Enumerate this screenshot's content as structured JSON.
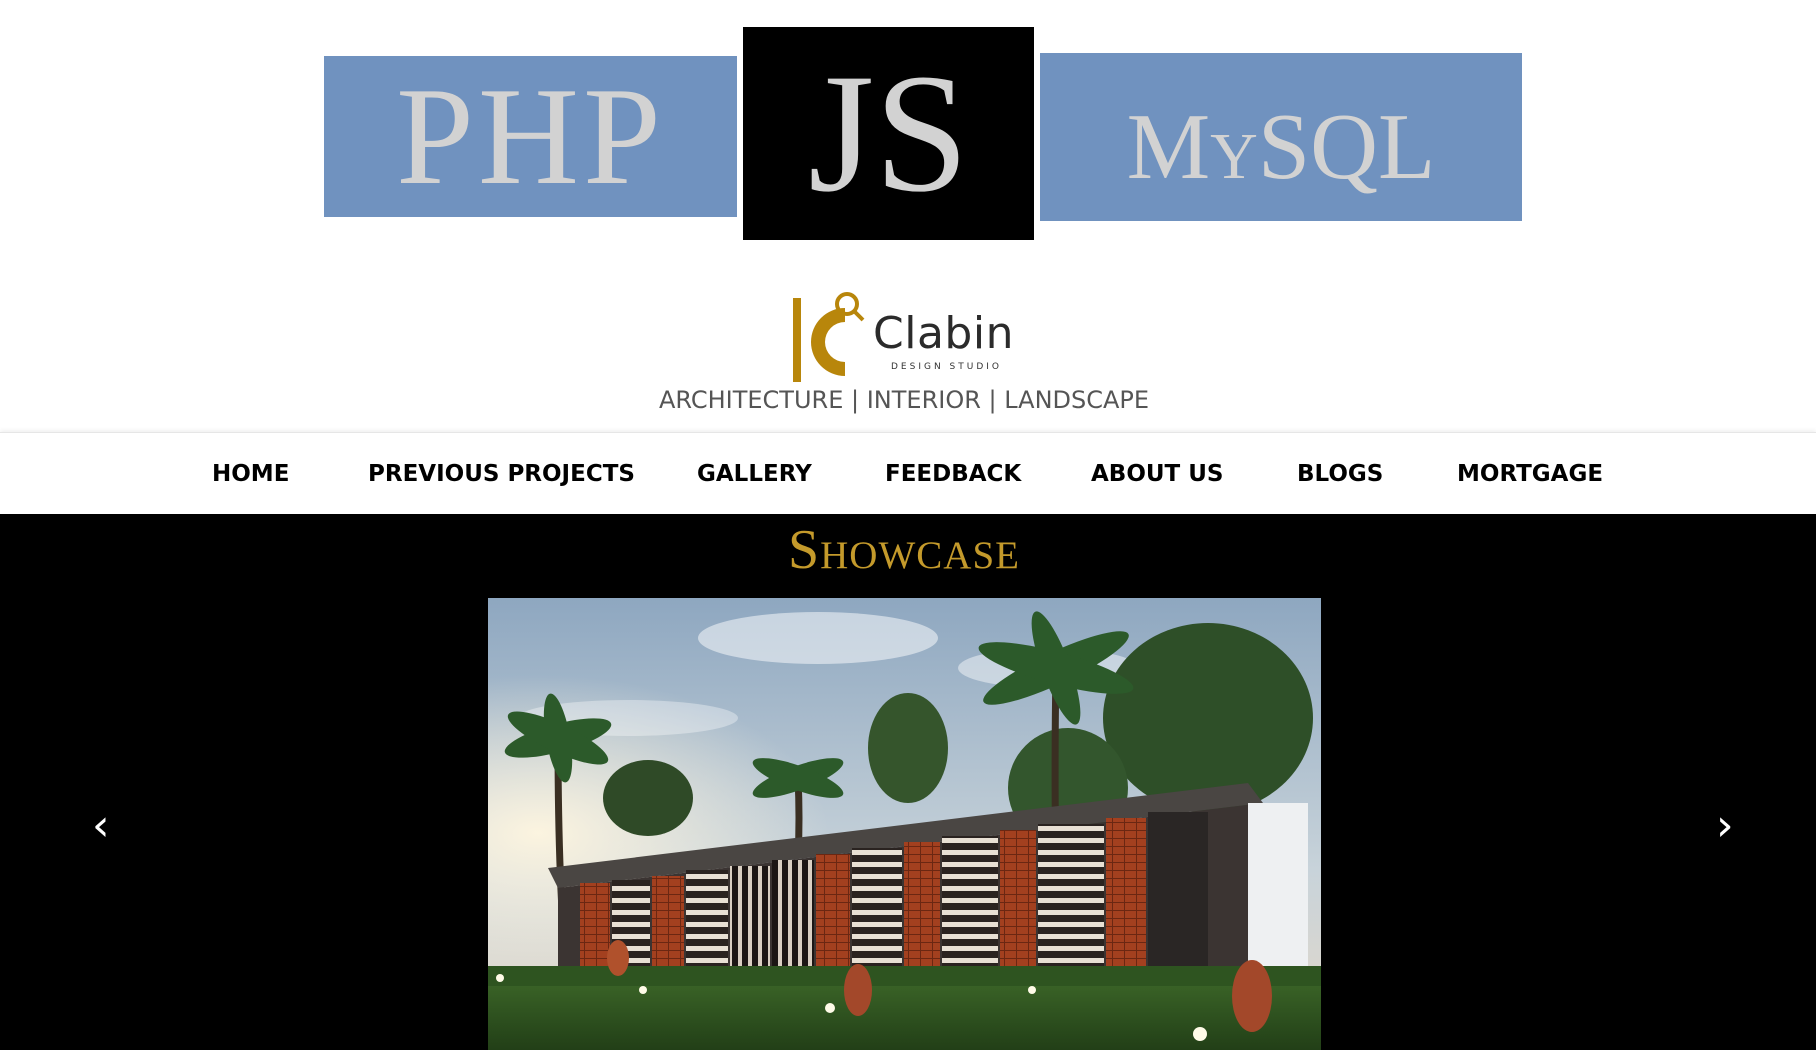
{
  "banner": {
    "php_label": "PHP",
    "js_label": "JS",
    "mysql_label": "MySQL",
    "colors": {
      "block_blue": "#7092bf",
      "block_black": "#000000",
      "text_gray": "#d2d2d2"
    }
  },
  "brand": {
    "name": "Clabin",
    "subtitle": "DESIGN STUDIO",
    "tagline": "ARCHITECTURE | INTERIOR | LANDSCAPE",
    "gold": "#b8860b"
  },
  "nav": {
    "items": [
      {
        "label": "HOME"
      },
      {
        "label": "PREVIOUS PROJECTS"
      },
      {
        "label": "GALLERY"
      },
      {
        "label": "FEEDBACK"
      },
      {
        "label": "ABOUT US"
      },
      {
        "label": "BLOGS"
      },
      {
        "label": "MORTGAGE"
      }
    ]
  },
  "showcase": {
    "title": "Showcase",
    "prev_icon": "‹",
    "next_icon": "›",
    "title_color": "#c49a2b"
  }
}
